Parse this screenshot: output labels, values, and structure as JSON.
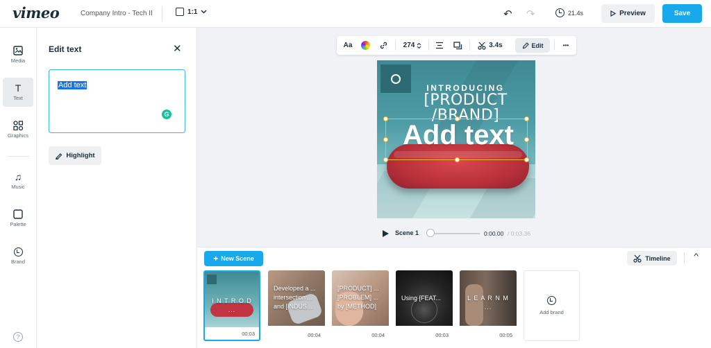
{
  "app": {
    "logo": "vimeo",
    "project_name": "Company Intro - Tech II",
    "aspect_ratio": "1:1",
    "duration": "21.4s",
    "preview_label": "Preview",
    "save_label": "Save",
    "accent_color": "#17a9ec"
  },
  "sidebar": {
    "items": [
      {
        "label": "Media",
        "icon": "image-icon"
      },
      {
        "label": "Text",
        "icon": "text-icon",
        "active": true
      },
      {
        "label": "Graphics",
        "icon": "shapes-icon"
      },
      {
        "label": "Music",
        "icon": "music-icon"
      },
      {
        "label": "Palette",
        "icon": "palette-icon"
      },
      {
        "label": "Brand",
        "icon": "brand-icon"
      }
    ],
    "help": "?"
  },
  "panel": {
    "title": "Edit text",
    "text_value": "Add text",
    "grammarly": "G",
    "highlight_label": "Highlight"
  },
  "toolbar": {
    "font_icon": "Aa",
    "font_size": "274",
    "duration": "3.4s",
    "edit_label": "Edit",
    "more": "•••"
  },
  "canvas": {
    "intro": "INTRODUCING",
    "product_line1": "[PRODUCT",
    "product_line2": "/BRAND]",
    "add_text": "Add text"
  },
  "player": {
    "scene_label": "Scene 1",
    "current_time": "0:00.00",
    "total_time": "/ 0:03.36"
  },
  "timeline": {
    "new_scene_label": "New Scene",
    "timeline_label": "Timeline",
    "scenes": [
      {
        "text": "I N T R O D ...",
        "duration": "00:03"
      },
      {
        "text": "Developed a ... intersection ... and [INDUS...",
        "duration": "00:04"
      },
      {
        "text": "[PRODUCT] ... [PROBLEM] ... by [METHOD]",
        "duration": "00:04"
      },
      {
        "text": "Using [FEAT...",
        "duration": "00:03"
      },
      {
        "text": "L E A R N M ...",
        "duration": "00:05"
      }
    ],
    "add_brand_label": "Add brand"
  }
}
